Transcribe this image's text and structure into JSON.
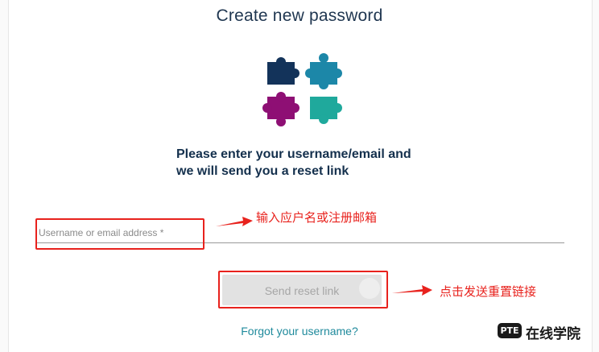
{
  "page": {
    "title": "Create new password",
    "heading_line1": "Please enter your username/email and",
    "heading_line2": "we will send you a reset link"
  },
  "form": {
    "username_placeholder": "Username or email address *",
    "username_value": "",
    "send_button_label": "Send reset link",
    "forgot_link": "Forgot your username?"
  },
  "annotations": {
    "input_hint": "输入应户名或注册邮箱",
    "button_hint": "点击发送重置链接"
  },
  "watermark": {
    "badge": "PTE",
    "text": "在线学院"
  },
  "icons": {
    "logo": "puzzle-pieces-icon",
    "arrows": "red-arrow-icon"
  },
  "colors": {
    "title": "#1f3650",
    "link": "#1f8a9c",
    "annotation_red": "#e8221d",
    "puzzle_navy": "#13335a",
    "puzzle_blue": "#1c87a8",
    "puzzle_magenta": "#8e0f74",
    "puzzle_teal": "#1fa99c"
  }
}
